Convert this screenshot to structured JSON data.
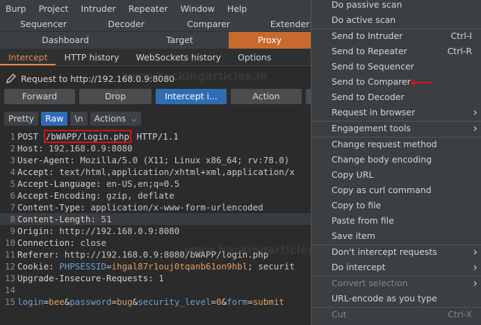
{
  "menubar": [
    "Burp",
    "Project",
    "Intruder",
    "Repeater",
    "Window",
    "Help"
  ],
  "tabs_row1": [
    "Sequencer",
    "Decoder",
    "Comparer",
    "Extender"
  ],
  "tabs_row2": [
    "Dashboard",
    "Target",
    "Proxy"
  ],
  "subtabs": [
    "Intercept",
    "HTTP history",
    "WebSockets history",
    "Options"
  ],
  "request_label": "Request to http://192.168.0.9:8080",
  "buttons": [
    "Forward",
    "Drop",
    "Intercept i...",
    "Action"
  ],
  "view": {
    "pretty": "Pretty",
    "raw": "Raw",
    "newline": "\\n",
    "actions": "Actions"
  },
  "request": [
    {
      "n": "1",
      "parts": [
        {
          "t": "POST "
        },
        {
          "t": "/bWAPP/login.php",
          "box": true
        },
        {
          "t": " HTTP/1.1"
        }
      ]
    },
    {
      "n": "2",
      "parts": [
        {
          "t": "Host: "
        },
        {
          "t": "192.168.0.9:8080",
          "c": "val"
        }
      ]
    },
    {
      "n": "3",
      "parts": [
        {
          "t": "User-Agent: "
        },
        {
          "t": "Mozilla/5.0 (X11; Linux x86_64; rv:78.0)",
          "c": "val"
        }
      ]
    },
    {
      "n": "4",
      "parts": [
        {
          "t": "Accept: "
        },
        {
          "t": "text/html,application/xhtml+xml,application/x",
          "c": "val"
        }
      ]
    },
    {
      "n": "5",
      "parts": [
        {
          "t": "Accept-Language: "
        },
        {
          "t": "en-US,en;q=0.5",
          "c": "val"
        }
      ]
    },
    {
      "n": "6",
      "parts": [
        {
          "t": "Accept-Encoding: "
        },
        {
          "t": "gzip, deflate",
          "c": "val"
        }
      ]
    },
    {
      "n": "7",
      "parts": [
        {
          "t": "Content-Type: "
        },
        {
          "t": "application/x-www-form-urlencoded",
          "c": "val"
        }
      ]
    },
    {
      "n": "8",
      "hl": true,
      "parts": [
        {
          "t": "Content-Length: "
        },
        {
          "t": "51",
          "c": "val"
        }
      ]
    },
    {
      "n": "9",
      "parts": [
        {
          "t": "Origin: "
        },
        {
          "t": "http://192.168.0.9:8080",
          "c": "val"
        }
      ]
    },
    {
      "n": "10",
      "parts": [
        {
          "t": "Connection: "
        },
        {
          "t": "close",
          "c": "val"
        }
      ]
    },
    {
      "n": "11",
      "parts": [
        {
          "t": "Referer: "
        },
        {
          "t": "http://192.168.0.9:8080/bWAPP/login.php",
          "c": "val"
        }
      ]
    },
    {
      "n": "12",
      "parts": [
        {
          "t": "Cookie: "
        },
        {
          "t": "PHPSESSID",
          "c": "blue"
        },
        {
          "t": "=",
          "c": "val"
        },
        {
          "t": "ihgal87r1ouj0tqanb61on9hbl",
          "c": "orange"
        },
        {
          "t": "; securit",
          "c": "val"
        }
      ]
    },
    {
      "n": "13",
      "parts": [
        {
          "t": "Upgrade-Insecure-Requests: "
        },
        {
          "t": "1",
          "c": "val"
        }
      ]
    },
    {
      "n": "14",
      "parts": []
    },
    {
      "n": "15",
      "parts": [
        {
          "t": "login",
          "c": "blue"
        },
        {
          "t": "="
        },
        {
          "t": "bee",
          "c": "orange"
        },
        {
          "t": "&"
        },
        {
          "t": "password",
          "c": "blue"
        },
        {
          "t": "="
        },
        {
          "t": "bug",
          "c": "orange"
        },
        {
          "t": "&"
        },
        {
          "t": "security_level",
          "c": "blue"
        },
        {
          "t": "="
        },
        {
          "t": "0",
          "c": "orange"
        },
        {
          "t": "&"
        },
        {
          "t": "form",
          "c": "blue"
        },
        {
          "t": "="
        },
        {
          "t": "submit",
          "c": "orange"
        }
      ]
    }
  ],
  "watermark": [
    "www.hackingarticles.in",
    "www.hackingarticles.in"
  ],
  "context_menu": [
    {
      "label": "Do passive scan"
    },
    {
      "label": "Do active scan"
    },
    {
      "sep": true
    },
    {
      "label": "Send to Intruder",
      "shortcut": "Ctrl-I"
    },
    {
      "label": "Send to Repeater",
      "shortcut": "Ctrl-R"
    },
    {
      "label": "Send to Sequencer"
    },
    {
      "label": "Send to Comparer"
    },
    {
      "label": "Send to Decoder"
    },
    {
      "label": "Request in browser",
      "submenu": true
    },
    {
      "sep": true
    },
    {
      "label": "Engagement tools",
      "submenu": true
    },
    {
      "sep": true
    },
    {
      "label": "Change request method"
    },
    {
      "label": "Change body encoding"
    },
    {
      "label": "Copy URL"
    },
    {
      "label": "Copy as curl command"
    },
    {
      "label": "Copy to file"
    },
    {
      "label": "Paste from file"
    },
    {
      "label": "Save item"
    },
    {
      "sep": true
    },
    {
      "label": "Don't intercept requests",
      "submenu": true
    },
    {
      "label": "Do intercept",
      "submenu": true
    },
    {
      "sep": true
    },
    {
      "label": "Convert selection",
      "submenu": true,
      "disabled": true
    },
    {
      "label": "URL-encode as you type"
    },
    {
      "sep": true
    },
    {
      "label": "Cut",
      "shortcut": "Ctrl-X",
      "disabled": true
    }
  ]
}
